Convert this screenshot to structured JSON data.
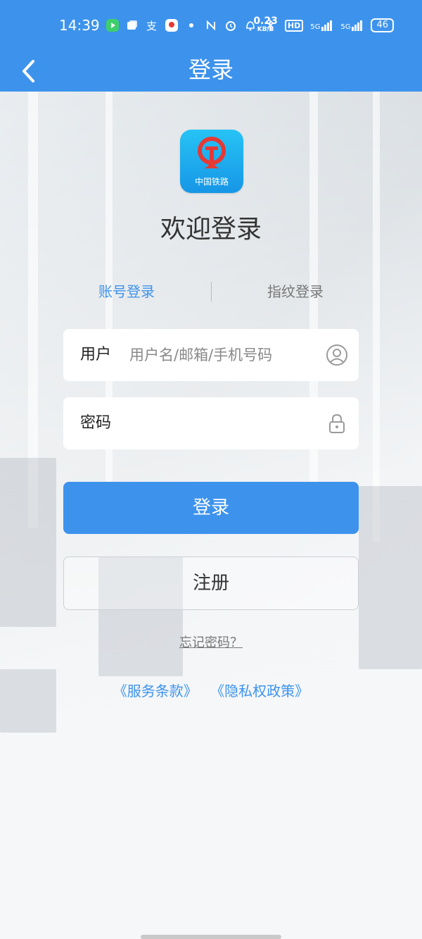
{
  "status_bar": {
    "time": "14:39",
    "speed_value": "0.23",
    "speed_unit": "KB/S",
    "hd": "HD",
    "network1": "5G",
    "network2": "5G",
    "battery": "46"
  },
  "navbar": {
    "back_icon": "chevron-left-icon",
    "title": "登录"
  },
  "logo": {
    "text": "中国铁路",
    "accent": "#e53935"
  },
  "welcome": "欢迎登录",
  "tabs": {
    "account": "账号登录",
    "fingerprint": "指纹登录"
  },
  "form": {
    "user_label": "用户",
    "user_placeholder": "用户名/邮箱/手机号码",
    "user_value": "",
    "password_label": "密码",
    "password_value": ""
  },
  "buttons": {
    "login": "登录",
    "register": "注册",
    "forgot": "忘记密码？"
  },
  "links": {
    "terms": "《服务条款》",
    "privacy": "《隐私权政策》"
  },
  "colors": {
    "primary": "#3d93ec",
    "text_dark": "#333333",
    "text_muted": "#777777"
  }
}
